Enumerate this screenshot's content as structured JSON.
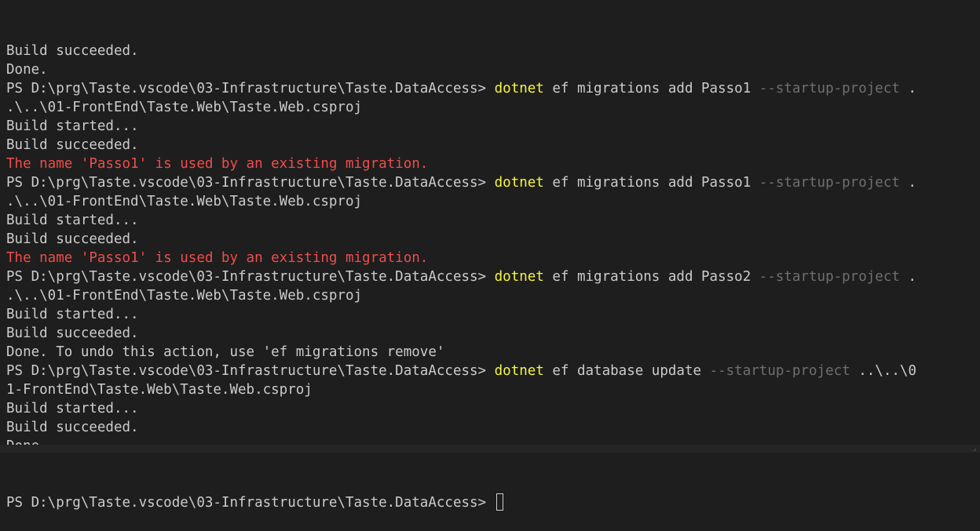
{
  "colors": {
    "background": "#1e1e1e",
    "text": "#cccccc",
    "command": "#f5f543",
    "flag": "#6f6f6f",
    "error": "#f14c4c"
  },
  "terminal": {
    "lines": [
      {
        "segments": [
          {
            "text": "Build succeeded.",
            "style": "normal"
          }
        ]
      },
      {
        "segments": [
          {
            "text": "Done.",
            "style": "normal"
          }
        ]
      },
      {
        "segments": [
          {
            "text": "PS D:\\prg\\Taste.vscode\\03-Infrastructure\\Taste.DataAccess> ",
            "style": "normal"
          },
          {
            "text": "dotnet",
            "style": "command"
          },
          {
            "text": " ef migrations add Passo1 ",
            "style": "normal"
          },
          {
            "text": "--startup-project",
            "style": "flag"
          },
          {
            "text": " .",
            "style": "normal"
          }
        ]
      },
      {
        "segments": [
          {
            "text": ".\\..\\01-FrontEnd\\Taste.Web\\Taste.Web.csproj",
            "style": "normal"
          }
        ]
      },
      {
        "segments": [
          {
            "text": "Build started...",
            "style": "normal"
          }
        ]
      },
      {
        "segments": [
          {
            "text": "Build succeeded.",
            "style": "normal"
          }
        ]
      },
      {
        "segments": [
          {
            "text": "The name 'Passo1' is used by an existing migration.",
            "style": "error"
          }
        ]
      },
      {
        "segments": [
          {
            "text": "PS D:\\prg\\Taste.vscode\\03-Infrastructure\\Taste.DataAccess> ",
            "style": "normal"
          },
          {
            "text": "dotnet",
            "style": "command"
          },
          {
            "text": " ef migrations add Passo1 ",
            "style": "normal"
          },
          {
            "text": "--startup-project",
            "style": "flag"
          },
          {
            "text": " .",
            "style": "normal"
          }
        ]
      },
      {
        "segments": [
          {
            "text": ".\\..\\01-FrontEnd\\Taste.Web\\Taste.Web.csproj",
            "style": "normal"
          }
        ]
      },
      {
        "segments": [
          {
            "text": "Build started...",
            "style": "normal"
          }
        ]
      },
      {
        "segments": [
          {
            "text": "Build succeeded.",
            "style": "normal"
          }
        ]
      },
      {
        "segments": [
          {
            "text": "The name 'Passo1' is used by an existing migration.",
            "style": "error"
          }
        ]
      },
      {
        "segments": [
          {
            "text": "PS D:\\prg\\Taste.vscode\\03-Infrastructure\\Taste.DataAccess> ",
            "style": "normal"
          },
          {
            "text": "dotnet",
            "style": "command"
          },
          {
            "text": " ef migrations add Passo2 ",
            "style": "normal"
          },
          {
            "text": "--startup-project",
            "style": "flag"
          },
          {
            "text": " .",
            "style": "normal"
          }
        ]
      },
      {
        "segments": [
          {
            "text": ".\\..\\01-FrontEnd\\Taste.Web\\Taste.Web.csproj",
            "style": "normal"
          }
        ]
      },
      {
        "segments": [
          {
            "text": "Build started...",
            "style": "normal"
          }
        ]
      },
      {
        "segments": [
          {
            "text": "Build succeeded.",
            "style": "normal"
          }
        ]
      },
      {
        "segments": [
          {
            "text": "Done. To undo this action, use 'ef migrations remove'",
            "style": "normal"
          }
        ]
      },
      {
        "segments": [
          {
            "text": "PS D:\\prg\\Taste.vscode\\03-Infrastructure\\Taste.DataAccess> ",
            "style": "normal"
          },
          {
            "text": "dotnet",
            "style": "command"
          },
          {
            "text": " ef database update ",
            "style": "normal"
          },
          {
            "text": "--startup-project",
            "style": "flag"
          },
          {
            "text": " ..\\..\\0",
            "style": "normal"
          }
        ]
      },
      {
        "segments": [
          {
            "text": "1-FrontEnd\\Taste.Web\\Taste.Web.csproj",
            "style": "normal"
          }
        ]
      },
      {
        "segments": [
          {
            "text": "Build started...",
            "style": "normal"
          }
        ]
      },
      {
        "segments": [
          {
            "text": "Build succeeded.",
            "style": "normal"
          }
        ]
      },
      {
        "segments": [
          {
            "text": "Done.",
            "style": "normal"
          }
        ]
      }
    ],
    "prompt": "PS D:\\prg\\Taste.vscode\\03-Infrastructure\\Taste.DataAccess> "
  },
  "scrollbar": {
    "corner_icon": "resize-grip-icon",
    "corner_glyph": "⌟"
  }
}
